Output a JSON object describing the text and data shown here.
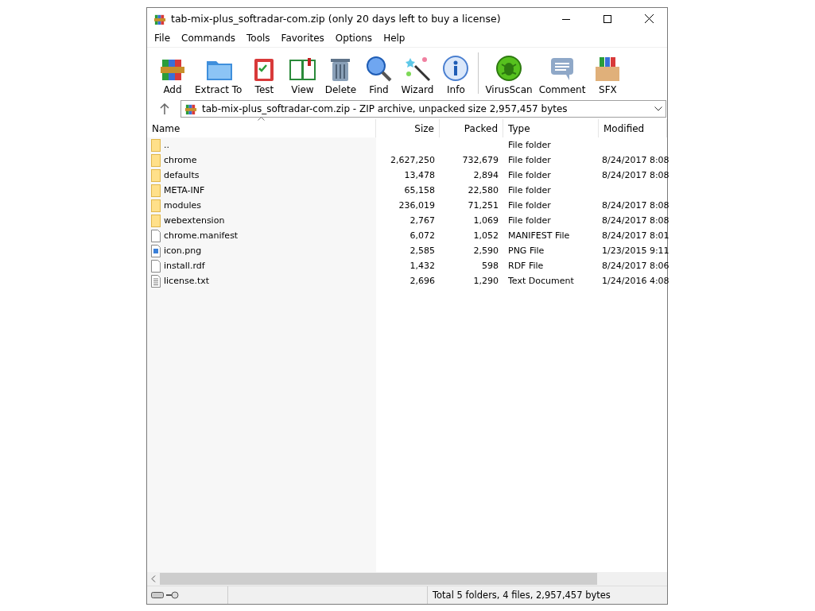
{
  "window": {
    "title": "tab-mix-plus_softradar-com.zip (only 20 days left to buy a license)"
  },
  "menu": [
    "File",
    "Commands",
    "Tools",
    "Favorites",
    "Options",
    "Help"
  ],
  "toolbar": [
    {
      "label": "Add"
    },
    {
      "label": "Extract To"
    },
    {
      "label": "Test"
    },
    {
      "label": "View"
    },
    {
      "label": "Delete"
    },
    {
      "label": "Find"
    },
    {
      "label": "Wizard"
    },
    {
      "label": "Info"
    },
    {
      "label": "VirusScan"
    },
    {
      "label": "Comment"
    },
    {
      "label": "SFX"
    }
  ],
  "address": {
    "path": "tab-mix-plus_softradar-com.zip - ZIP archive, unpacked size 2,957,457 bytes"
  },
  "table": {
    "columns": [
      "Name",
      "Size",
      "Packed",
      "Type",
      "Modified"
    ],
    "rows": [
      {
        "kind": "folder",
        "name": "..",
        "size": "",
        "packed": "",
        "type": "File folder",
        "modified": ""
      },
      {
        "kind": "folder",
        "name": "chrome",
        "size": "2,627,250",
        "packed": "732,679",
        "type": "File folder",
        "modified": "8/24/2017 8:08"
      },
      {
        "kind": "folder",
        "name": "defaults",
        "size": "13,478",
        "packed": "2,894",
        "type": "File folder",
        "modified": "8/24/2017 8:08"
      },
      {
        "kind": "folder",
        "name": "META-INF",
        "size": "65,158",
        "packed": "22,580",
        "type": "File folder",
        "modified": ""
      },
      {
        "kind": "folder",
        "name": "modules",
        "size": "236,019",
        "packed": "71,251",
        "type": "File folder",
        "modified": "8/24/2017 8:08"
      },
      {
        "kind": "folder",
        "name": "webextension",
        "size": "2,767",
        "packed": "1,069",
        "type": "File folder",
        "modified": "8/24/2017 8:08"
      },
      {
        "kind": "file",
        "name": "chrome.manifest",
        "size": "6,072",
        "packed": "1,052",
        "type": "MANIFEST File",
        "modified": "8/24/2017 8:01"
      },
      {
        "kind": "image",
        "name": "icon.png",
        "size": "2,585",
        "packed": "2,590",
        "type": "PNG File",
        "modified": "1/23/2015 9:11"
      },
      {
        "kind": "file",
        "name": "install.rdf",
        "size": "1,432",
        "packed": "598",
        "type": "RDF File",
        "modified": "8/24/2017 8:06"
      },
      {
        "kind": "text",
        "name": "license.txt",
        "size": "2,696",
        "packed": "1,290",
        "type": "Text Document",
        "modified": "1/24/2016 4:08"
      }
    ]
  },
  "status_bar": {
    "text": "Total 5 folders, 4 files, 2,957,457 bytes"
  }
}
